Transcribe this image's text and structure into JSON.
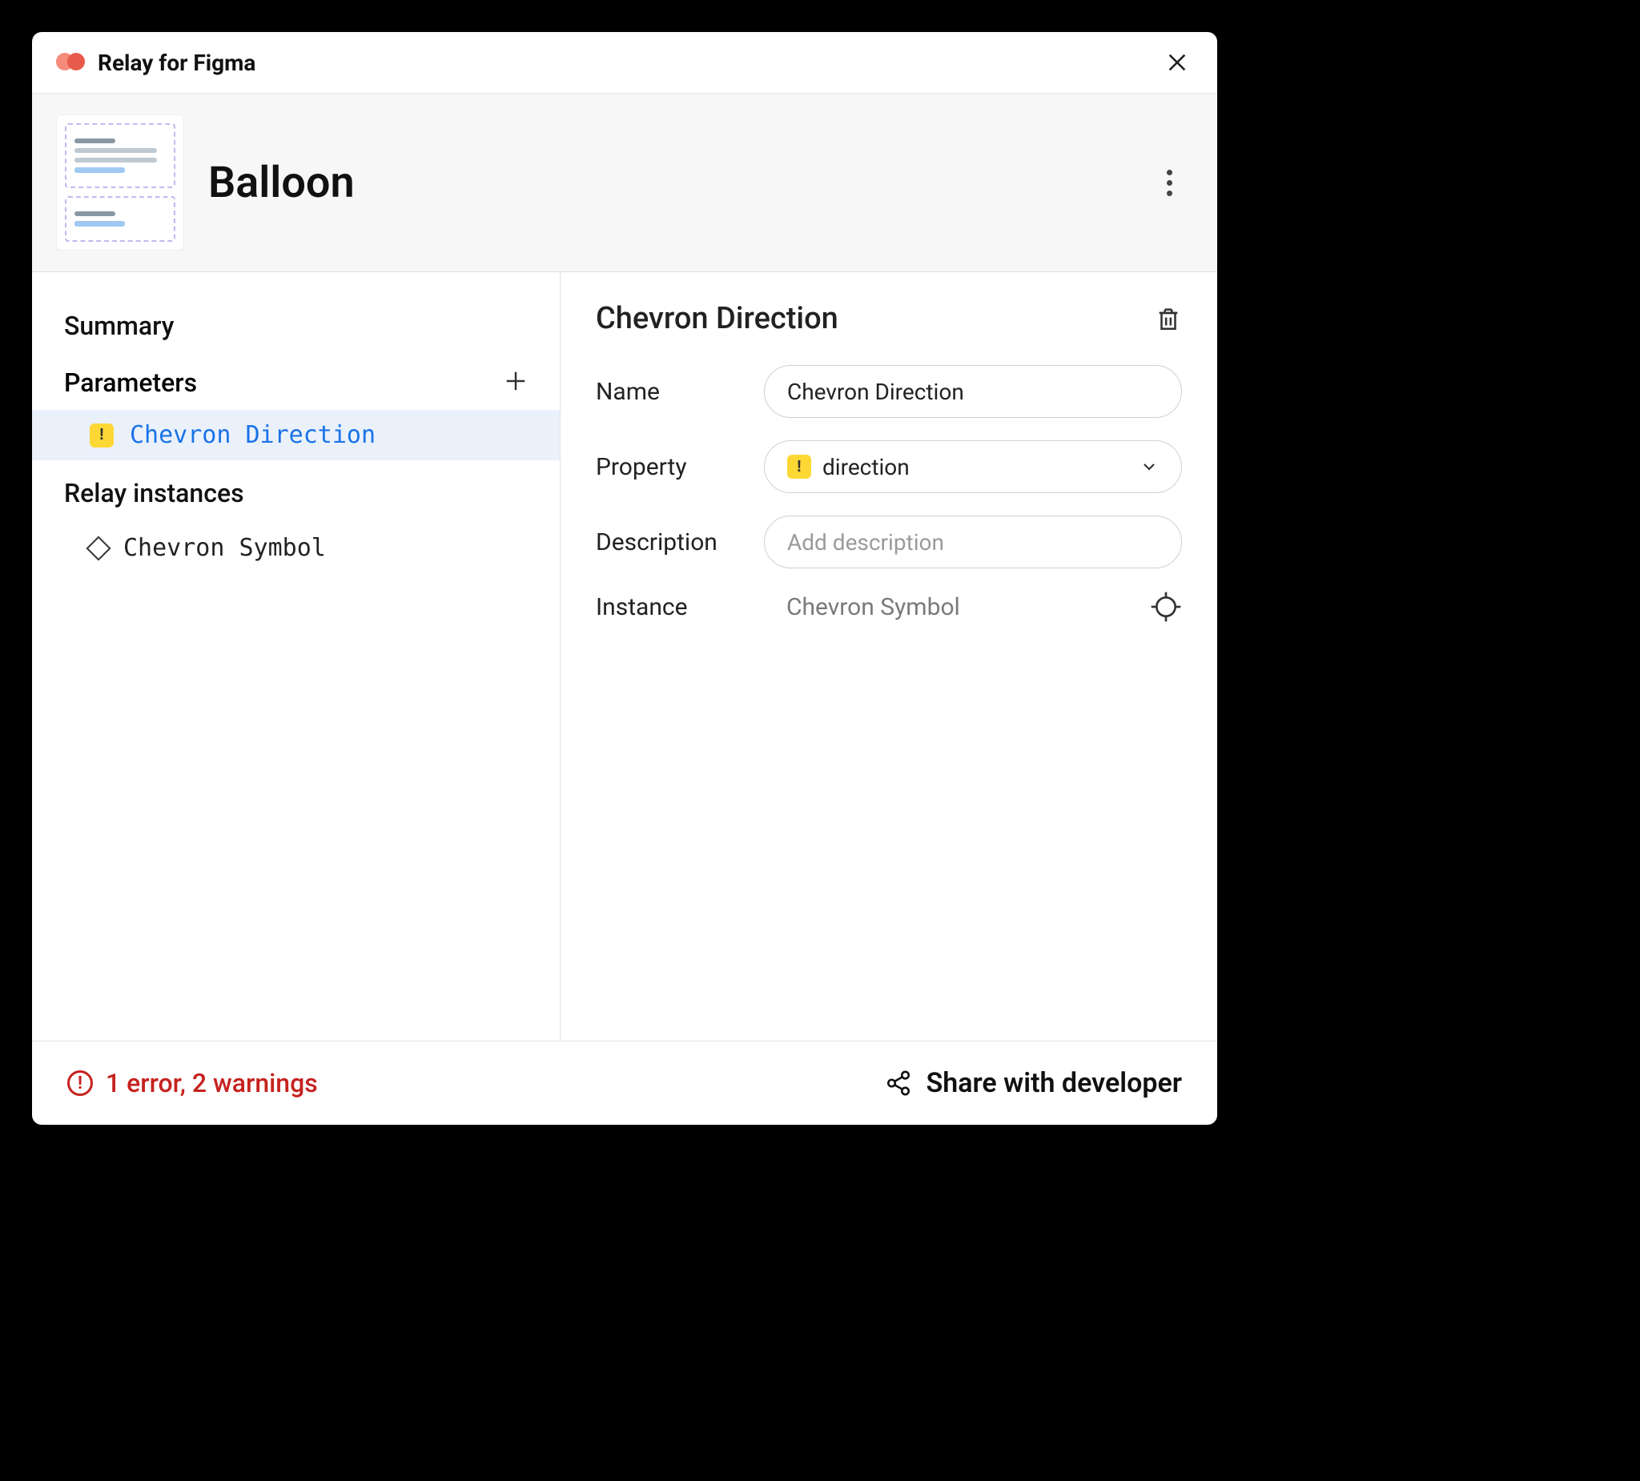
{
  "titlebar": {
    "title": "Relay for Figma"
  },
  "header": {
    "component_name": "Balloon"
  },
  "sidebar": {
    "summary_label": "Summary",
    "parameters_label": "Parameters",
    "relay_instances_label": "Relay instances",
    "parameters": [
      {
        "name": "Chevron Direction",
        "warning": true
      }
    ],
    "instances": [
      {
        "name": "Chevron Symbol"
      }
    ]
  },
  "detail": {
    "title": "Chevron Direction",
    "fields": {
      "name_label": "Name",
      "name_value": "Chevron Direction",
      "property_label": "Property",
      "property_value": "direction",
      "property_warning": true,
      "description_label": "Description",
      "description_placeholder": "Add description",
      "instance_label": "Instance",
      "instance_value": "Chevron Symbol"
    }
  },
  "footer": {
    "errors_text": "1 error, 2 warnings",
    "share_label": "Share with developer"
  }
}
